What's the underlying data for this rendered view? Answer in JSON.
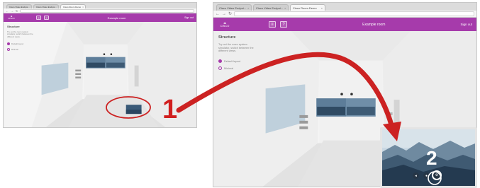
{
  "left_window": {
    "tabs": [
      {
        "label": "Cisco Video Endpoi...",
        "active": false
      },
      {
        "label": "Cisco Video Endpoi...",
        "active": false
      },
      {
        "label": "Cisco Room Demo",
        "active": true
      }
    ],
    "url": "",
    "app": {
      "logo_text": "CISCO",
      "title": "Example room",
      "link": "Sign out"
    },
    "sidebar": {
      "heading": "Structure",
      "description": "Try out the room system simulator, switch between the different views.",
      "options": [
        {
          "label": "Default layout",
          "selected": true
        },
        {
          "label": "Minimal",
          "selected": false
        }
      ]
    }
  },
  "right_window": {
    "tabs": [
      {
        "label": "Cisco Video Endpoi...",
        "active": false
      },
      {
        "label": "Cisco Video Endpoi...",
        "active": false
      },
      {
        "label": "Cisco Room Demo",
        "active": true
      }
    ],
    "url": "",
    "app": {
      "logo_text": "CISCO",
      "title": "Example room",
      "link": "Sign out"
    },
    "sidebar": {
      "heading": "Structure",
      "description": "Try out the room system simulator, switch between the different views.",
      "options": [
        {
          "label": "Default layout",
          "selected": true
        },
        {
          "label": "Minimal",
          "selected": false
        }
      ]
    }
  },
  "annotations": {
    "step1": "1",
    "step2": "2",
    "arrow_color": "#cc2222",
    "accent_color": "#a63bab"
  },
  "icons": {
    "back": "back-arrow-icon",
    "forward": "forward-arrow-icon",
    "reload": "reload-icon",
    "menu": "menu-icon",
    "help": "help-icon"
  }
}
